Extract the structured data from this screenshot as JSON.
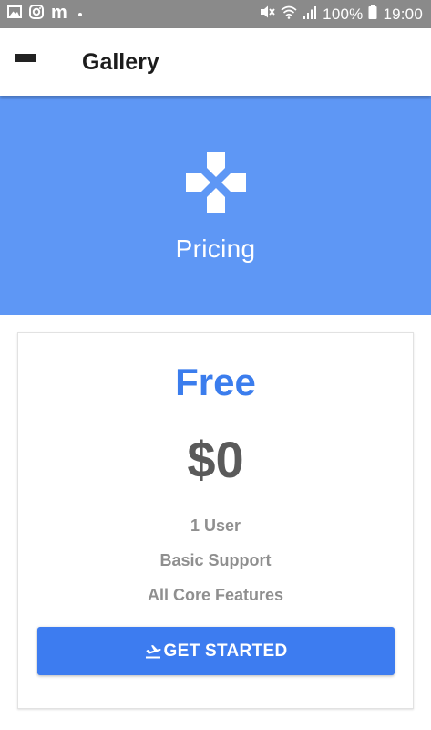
{
  "status_bar": {
    "battery": "100%",
    "time": "19:00",
    "icons": [
      "gallery-icon",
      "instagram-icon",
      "m-app-icon",
      "mute-icon",
      "wifi-icon",
      "signal-icon",
      "battery-icon"
    ],
    "m_label": "m"
  },
  "app_bar": {
    "title": "Gallery",
    "menu_icon": "hamburger-menu-icon"
  },
  "hero": {
    "title": "Pricing",
    "icon": "gamepad-icon",
    "background": "#5e97f5"
  },
  "plan": {
    "name": "Free",
    "price": "$0",
    "features": [
      "1 User",
      "Basic Support",
      "All Core Features"
    ],
    "cta_label": "GET STARTED",
    "cta_icon": "flight-takeoff-icon",
    "accent": "#3b7ded"
  }
}
